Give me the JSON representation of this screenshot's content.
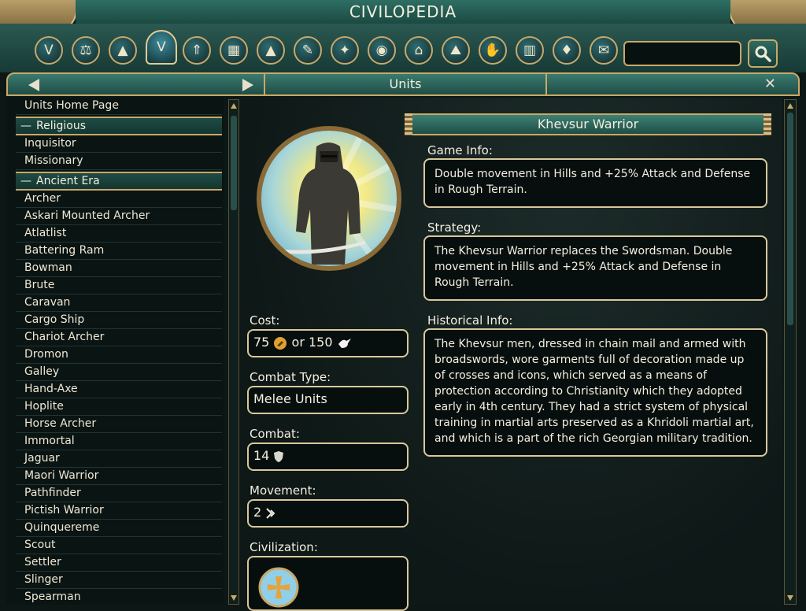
{
  "header": {
    "title": "CIVILOPEDIA"
  },
  "categories": [
    {
      "name": "victory",
      "glyph": "V"
    },
    {
      "name": "concepts",
      "glyph": "⚖"
    },
    {
      "name": "techs",
      "glyph": "▲"
    },
    {
      "name": "units",
      "glyph": "V"
    },
    {
      "name": "promotions",
      "glyph": "⇑"
    },
    {
      "name": "buildings",
      "glyph": "▦"
    },
    {
      "name": "wonders",
      "glyph": "▲"
    },
    {
      "name": "policies",
      "glyph": "✎"
    },
    {
      "name": "great-people",
      "glyph": "✦"
    },
    {
      "name": "civilizations",
      "glyph": "◉"
    },
    {
      "name": "city-states",
      "glyph": "⌂"
    },
    {
      "name": "terrain",
      "glyph": "⛰"
    },
    {
      "name": "resources",
      "glyph": "✋"
    },
    {
      "name": "improvements",
      "glyph": "▥"
    },
    {
      "name": "religion",
      "glyph": "♦"
    },
    {
      "name": "world-congress",
      "glyph": "✉"
    }
  ],
  "search": {
    "placeholder": ""
  },
  "nav": {
    "section_title": "Units",
    "close_glyph": "✕"
  },
  "sidebar": {
    "items": [
      {
        "label": "Units Home Page",
        "header": false
      },
      {
        "label": "Religious",
        "header": true
      },
      {
        "label": "Inquisitor",
        "header": false
      },
      {
        "label": "Missionary",
        "header": false
      },
      {
        "label": "Ancient Era",
        "header": true
      },
      {
        "label": "Archer",
        "header": false
      },
      {
        "label": "Askari Mounted Archer",
        "header": false
      },
      {
        "label": "Atlatlist",
        "header": false
      },
      {
        "label": "Battering Ram",
        "header": false
      },
      {
        "label": "Bowman",
        "header": false
      },
      {
        "label": "Brute",
        "header": false
      },
      {
        "label": "Caravan",
        "header": false
      },
      {
        "label": "Cargo Ship",
        "header": false
      },
      {
        "label": "Chariot Archer",
        "header": false
      },
      {
        "label": "Dromon",
        "header": false
      },
      {
        "label": "Galley",
        "header": false
      },
      {
        "label": "Hand-Axe",
        "header": false
      },
      {
        "label": "Hoplite",
        "header": false
      },
      {
        "label": "Horse Archer",
        "header": false
      },
      {
        "label": "Immortal",
        "header": false
      },
      {
        "label": "Jaguar",
        "header": false
      },
      {
        "label": "Maori Warrior",
        "header": false
      },
      {
        "label": "Pathfinder",
        "header": false
      },
      {
        "label": "Pictish Warrior",
        "header": false
      },
      {
        "label": "Quinquereme",
        "header": false
      },
      {
        "label": "Scout",
        "header": false
      },
      {
        "label": "Settler",
        "header": false
      },
      {
        "label": "Slinger",
        "header": false
      },
      {
        "label": "Spearman",
        "header": false
      }
    ],
    "header_dash": "—"
  },
  "unit": {
    "name": "Khevsur Warrior",
    "game_info_label": "Game Info:",
    "game_info": "Double movement in Hills and +25% Attack and Defense in Rough Terrain.",
    "strategy_label": "Strategy:",
    "strategy": "The Khevsur Warrior replaces the Swordsman. Double movement in Hills and +25% Attack and Defense in Rough Terrain.",
    "history_label": "Historical Info:",
    "history": "The Khevsur men, dressed in chain mail and armed with broadswords, wore garments full of decoration made up of crosses and icons, which served as a means of protection according to Christianity which they adopted early in 4th century. They had a strict system of physical training in martial arts preserved as a Khridoli martial art, and which is a part of the rich Georgian military tradition.",
    "cost_label": "Cost:",
    "cost_production": "75",
    "cost_or": "or 150",
    "combat_type_label": "Combat Type:",
    "combat_type": "Melee Units",
    "combat_label": "Combat:",
    "combat": "14",
    "movement_label": "Movement:",
    "movement": "2",
    "civilization_label": "Civilization:"
  },
  "colors": {
    "accent_gold": "#c9a868",
    "panel_teal": "#1f4d46",
    "production_orange": "#e0a030",
    "faith_white": "#f2f2f2",
    "civ_emblem_blue": "#8fd0e8"
  }
}
